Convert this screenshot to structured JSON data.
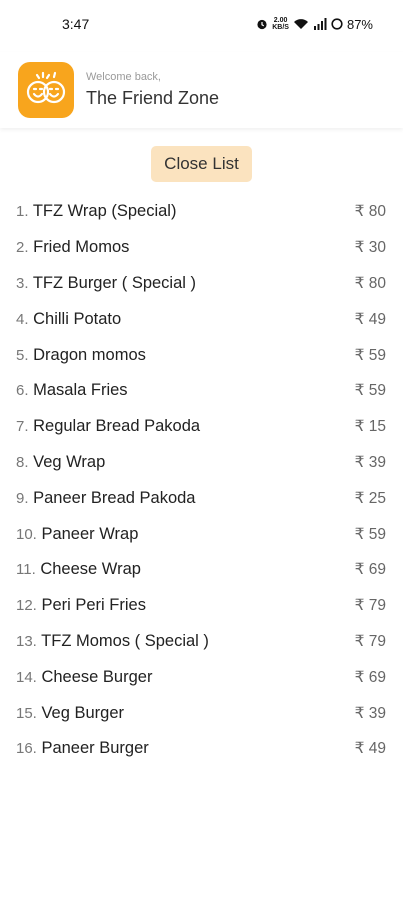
{
  "status_bar": {
    "time": "3:47",
    "net_speed_top": "2.00",
    "net_speed_bottom": "KB/S",
    "battery": "87%"
  },
  "header": {
    "welcome": "Welcome back,",
    "shop_name": "The Friend Zone",
    "logo_color": "#f8a51d"
  },
  "close_button": {
    "label": "Close List",
    "color": "#fbe3bf"
  },
  "menu": [
    {
      "num": "1.",
      "name": "TFZ Wrap (Special)",
      "price": "₹ 80"
    },
    {
      "num": "2.",
      "name": "Fried Momos",
      "price": "₹ 30"
    },
    {
      "num": "3.",
      "name": "TFZ Burger ( Special )",
      "price": "₹ 80"
    },
    {
      "num": "4.",
      "name": "Chilli Potato",
      "price": "₹ 49"
    },
    {
      "num": "5.",
      "name": "Dragon momos",
      "price": "₹ 59"
    },
    {
      "num": "6.",
      "name": "Masala Fries",
      "price": "₹ 59"
    },
    {
      "num": "7.",
      "name": "Regular Bread Pakoda",
      "price": "₹ 15"
    },
    {
      "num": "8.",
      "name": "Veg Wrap",
      "price": "₹ 39"
    },
    {
      "num": "9.",
      "name": "Paneer Bread Pakoda",
      "price": "₹ 25"
    },
    {
      "num": "10.",
      "name": "Paneer Wrap",
      "price": "₹ 59"
    },
    {
      "num": "11.",
      "name": "Cheese Wrap",
      "price": "₹ 69"
    },
    {
      "num": "12.",
      "name": "Peri Peri Fries",
      "price": "₹ 79"
    },
    {
      "num": "13.",
      "name": "TFZ Momos ( Special )",
      "price": "₹ 79"
    },
    {
      "num": "14.",
      "name": "Cheese Burger",
      "price": "₹ 69"
    },
    {
      "num": "15.",
      "name": "Veg Burger",
      "price": "₹ 39"
    },
    {
      "num": "16.",
      "name": "Paneer Burger",
      "price": "₹ 49"
    }
  ]
}
